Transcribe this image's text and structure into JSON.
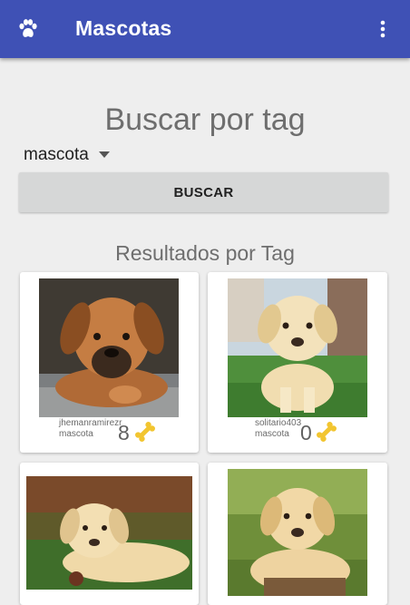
{
  "appbar": {
    "title": "Mascotas",
    "logo_icon": "paw-icon",
    "menu_icon": "more-vertical-icon",
    "color": "#3f51b5"
  },
  "search": {
    "heading": "Buscar por tag",
    "tag_value": "mascota",
    "button_label": "BUSCAR"
  },
  "results": {
    "heading": "Resultados por Tag",
    "items": [
      {
        "user": "jhemanramirezr",
        "tag": "mascota",
        "likes": "8",
        "like_icon": "bone-icon"
      },
      {
        "user": "solitario403",
        "tag": "mascota",
        "likes": "0",
        "like_icon": "bone-icon"
      },
      {
        "user": "",
        "tag": "",
        "likes": "",
        "like_icon": "bone-icon"
      },
      {
        "user": "",
        "tag": "",
        "likes": "",
        "like_icon": "bone-icon"
      }
    ]
  }
}
